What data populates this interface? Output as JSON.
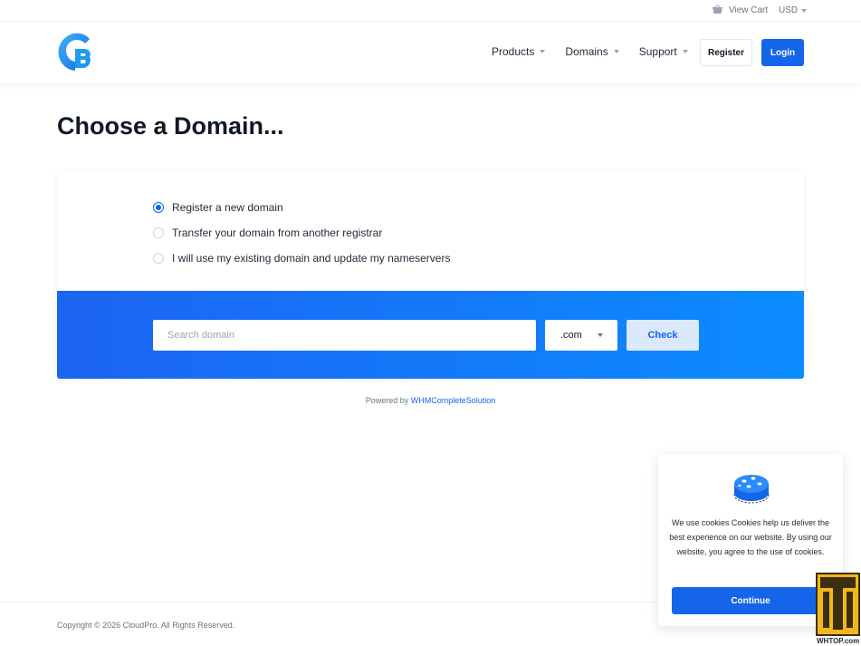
{
  "topbar": {
    "cart_label": "View Cart",
    "cart_icon": "basket-icon",
    "currency": "USD"
  },
  "header": {
    "logo_icon": "cloudpro-logo-icon",
    "nav": [
      {
        "label": "Products"
      },
      {
        "label": "Domains"
      },
      {
        "label": "Support"
      }
    ],
    "register_label": "Register",
    "login_label": "Login"
  },
  "page": {
    "title": "Choose a Domain..."
  },
  "domain_options": [
    {
      "label": "Register a new domain",
      "selected": true
    },
    {
      "label": "Transfer your domain from another registrar",
      "selected": false
    },
    {
      "label": "I will use my existing domain and update my nameservers",
      "selected": false
    }
  ],
  "search": {
    "placeholder": "Search domain",
    "value": "",
    "tld_selected": ".com",
    "check_label": "Check"
  },
  "powered": {
    "prefix": "Powered by",
    "link": "WHMCompleteSolution"
  },
  "footer": {
    "copyright": "Copyright © 2026 CloudPro. All Rights Reserved."
  },
  "cookie": {
    "icon": "cookie-icon",
    "text": "We use cookies Cookies help us deliver the best experience on our website. By using our website, you agree to the use of cookies.",
    "continue_label": "Continue"
  },
  "watermark": {
    "text": "WHTOP.com"
  },
  "colors": {
    "primary": "#1565ea",
    "gradient_start": "#1c64f2",
    "gradient_end": "#0c8cff"
  }
}
